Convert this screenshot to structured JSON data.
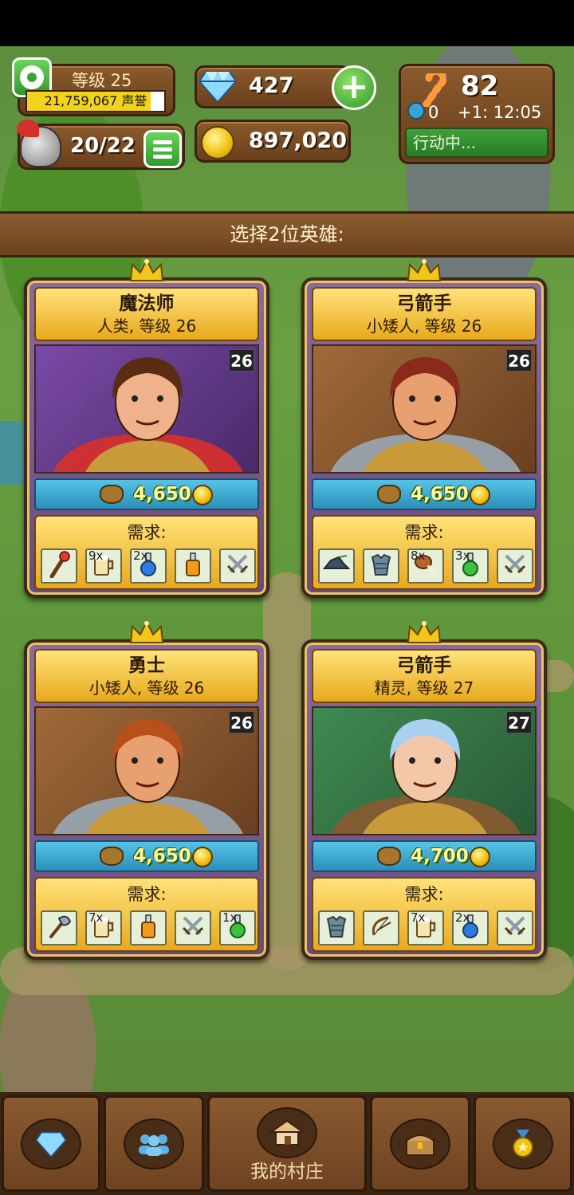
{
  "hud": {
    "level_label": "等级 25",
    "reputation_text": "21,759,067 声誉",
    "reputation_progress": 0.9,
    "heroes_count": "20/22",
    "gems": "427",
    "gold": "897,020",
    "candy": "82",
    "horn_count": "0",
    "horn_timer": "+1: 12:05",
    "status_text": "行动中..."
  },
  "banner": {
    "text": "选择2位英雄:"
  },
  "cards": [
    {
      "name": "魔法师",
      "subtitle": "人类, 等级 26",
      "level": "26",
      "price": "4,650",
      "req_label": "需求:",
      "requirements": [
        {
          "icon": "staff-icon",
          "qty": ""
        },
        {
          "icon": "mug-icon",
          "qty": "9x"
        },
        {
          "icon": "blue-potion-icon",
          "qty": "2x"
        },
        {
          "icon": "orange-potion-icon",
          "qty": ""
        },
        {
          "icon": "crossed-swords-icon",
          "qty": ""
        }
      ]
    },
    {
      "name": "弓箭手",
      "subtitle": "小矮人, 等级 26",
      "level": "26",
      "price": "4,650",
      "req_label": "需求:",
      "requirements": [
        {
          "icon": "hat-icon",
          "qty": ""
        },
        {
          "icon": "armor-icon",
          "qty": ""
        },
        {
          "icon": "meat-icon",
          "qty": "8x"
        },
        {
          "icon": "green-potion-icon",
          "qty": "3x"
        },
        {
          "icon": "crossed-swords-icon",
          "qty": ""
        }
      ]
    },
    {
      "name": "勇士",
      "subtitle": "小矮人, 等级 26",
      "level": "26",
      "price": "4,650",
      "req_label": "需求:",
      "requirements": [
        {
          "icon": "axe-icon",
          "qty": ""
        },
        {
          "icon": "mug-icon",
          "qty": "7x"
        },
        {
          "icon": "orange-potion-icon",
          "qty": ""
        },
        {
          "icon": "crossed-swords-icon",
          "qty": ""
        },
        {
          "icon": "green-potion-icon",
          "qty": "1x"
        }
      ]
    },
    {
      "name": "弓箭手",
      "subtitle": "精灵, 等级 27",
      "level": "27",
      "price": "4,700",
      "req_label": "需求:",
      "requirements": [
        {
          "icon": "armor-icon",
          "qty": ""
        },
        {
          "icon": "bow-icon",
          "qty": ""
        },
        {
          "icon": "mug-icon",
          "qty": "7x"
        },
        {
          "icon": "blue-potion-icon",
          "qty": "2x"
        },
        {
          "icon": "crossed-swords-icon",
          "qty": ""
        }
      ]
    }
  ],
  "nav": {
    "center_label": "我的村庄"
  }
}
